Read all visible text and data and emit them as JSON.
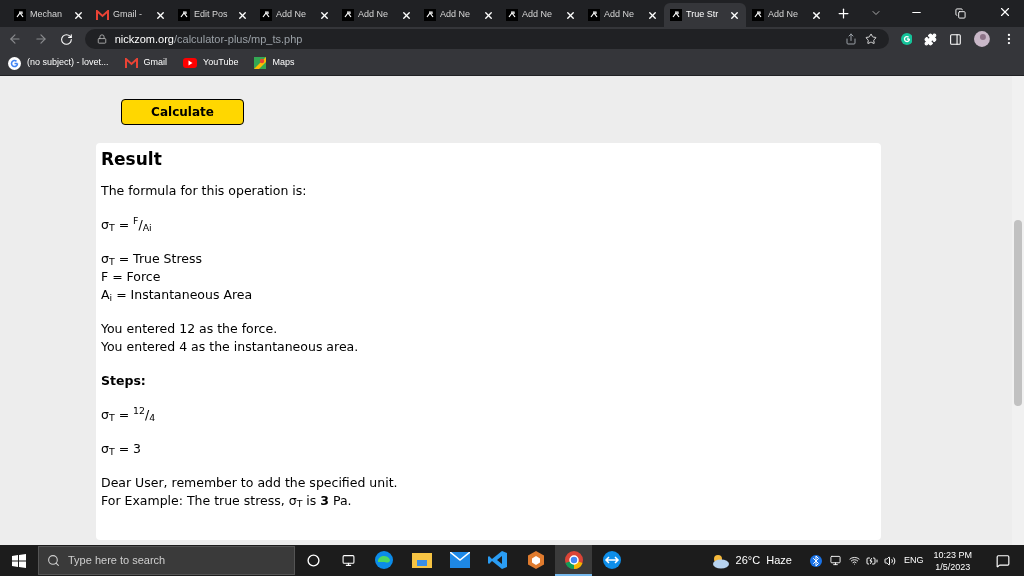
{
  "tabs": [
    {
      "label": "Mechan",
      "kind": "site",
      "selected": false
    },
    {
      "label": "Gmail - ",
      "kind": "gmail",
      "selected": false
    },
    {
      "label": "Edit Pos",
      "kind": "site",
      "selected": false
    },
    {
      "label": "Add Ne",
      "kind": "site",
      "selected": false
    },
    {
      "label": "Add Ne",
      "kind": "site",
      "selected": false
    },
    {
      "label": "Add Ne",
      "kind": "site",
      "selected": false
    },
    {
      "label": "Add Ne",
      "kind": "site",
      "selected": false
    },
    {
      "label": "Add Ne",
      "kind": "site",
      "selected": false
    },
    {
      "label": "True Str",
      "kind": "site",
      "selected": true
    },
    {
      "label": "Add Ne",
      "kind": "site",
      "selected": false
    }
  ],
  "address": {
    "domain": "nickzom.org",
    "path": "/calculator-plus/mp_ts.php"
  },
  "bookmarks": [
    {
      "label": "(no subject) - lovet...",
      "kind": "google"
    },
    {
      "label": "Gmail",
      "kind": "gmail"
    },
    {
      "label": "YouTube",
      "kind": "youtube"
    },
    {
      "label": "Maps",
      "kind": "maps"
    }
  ],
  "calculate_button": "Calculate",
  "result": {
    "title": "Result",
    "blocks": [
      {
        "kind": "para",
        "lines": [
          "The formula for this operation is:"
        ]
      },
      {
        "kind": "para",
        "lines": [
          "σ$_{T}$ = $^{F}$/$_{Ai}$"
        ]
      },
      {
        "kind": "para",
        "lines": [
          "σ$_{T}$ = True Stress",
          "F = Force",
          "A$_{i}$ = Instantaneous Area"
        ]
      },
      {
        "kind": "para",
        "lines": [
          "You entered 12 as the force.",
          "You entered 4 as the instantaneous area."
        ]
      },
      {
        "kind": "heading",
        "lines": [
          "Steps:"
        ]
      },
      {
        "kind": "para",
        "lines": [
          "σ$_{T}$ = $^{12}$/$_{4}$"
        ]
      },
      {
        "kind": "para",
        "lines": [
          "σ$_{T}$ = 3"
        ]
      },
      {
        "kind": "para",
        "lines": [
          "Dear User, remember to add the specified unit.",
          "For Example: The true stress, σ$_{T}$ is **3** Pa."
        ]
      }
    ]
  },
  "taskbar": {
    "search_placeholder": "Type here to search",
    "apps": [
      {
        "kind": "edge",
        "selected": false
      },
      {
        "kind": "explorer",
        "selected": false
      },
      {
        "kind": "mail",
        "selected": false
      },
      {
        "kind": "vscode",
        "selected": false
      },
      {
        "kind": "cube",
        "selected": false
      },
      {
        "kind": "chrome",
        "selected": true
      },
      {
        "kind": "teamviewer",
        "selected": false
      }
    ],
    "weather": "26°C  Haze",
    "language": "ENG",
    "time": "10:23 PM",
    "date": "1/5/2023"
  }
}
